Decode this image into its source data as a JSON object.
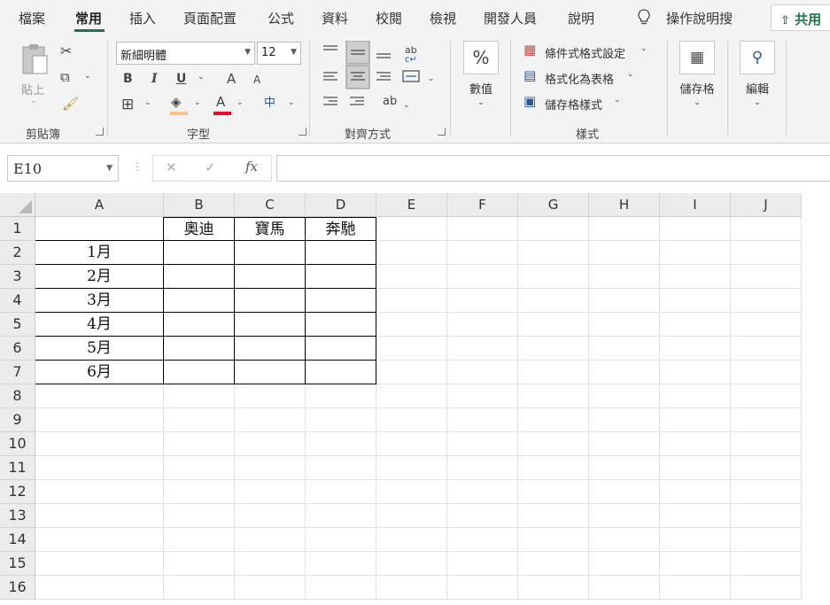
{
  "tabs": [
    "檔案",
    "常用",
    "插入",
    "頁面配置",
    "公式",
    "資料",
    "校閱",
    "檢視",
    "開發人員",
    "說明",
    "操作說明搜"
  ],
  "share_label": "共用",
  "ribbon": {
    "clipboard": {
      "paste_label": "貼上",
      "group_label": "剪貼簿"
    },
    "font": {
      "font_name": "新細明體",
      "font_size": "12",
      "bold": "B",
      "italic": "I",
      "underline": "U",
      "grow": "A",
      "shrink": "A",
      "font_color": "A",
      "phonetic": "中",
      "group_label": "字型"
    },
    "alignment": {
      "group_label": "對齊方式"
    },
    "number": {
      "symbol": "%",
      "label": "數值"
    },
    "styles": {
      "conditional": "條件式格式設定",
      "as_table": "格式化為表格",
      "cell_styles": "儲存格樣式",
      "group_label": "樣式"
    },
    "cells": {
      "label": "儲存格"
    },
    "editing": {
      "label": "編輯"
    }
  },
  "formula_bar": {
    "name_box": "E10",
    "cancel": "✕",
    "enter": "✓",
    "fx": "fx",
    "formula": ""
  },
  "sheet": {
    "columns": [
      "A",
      "B",
      "C",
      "D",
      "E",
      "F",
      "G",
      "H",
      "I",
      "J"
    ],
    "rows": [
      "1",
      "2",
      "3",
      "4",
      "5",
      "6",
      "7",
      "8",
      "9",
      "10",
      "11",
      "12",
      "13",
      "14",
      "15",
      "16"
    ],
    "cells": [
      [
        "",
        "奧迪",
        "寶馬",
        "奔馳"
      ],
      [
        "1月",
        "",
        "",
        ""
      ],
      [
        "2月",
        "",
        "",
        ""
      ],
      [
        "3月",
        "",
        "",
        ""
      ],
      [
        "4月",
        "",
        "",
        ""
      ],
      [
        "5月",
        "",
        "",
        ""
      ],
      [
        "6月",
        "",
        "",
        ""
      ]
    ]
  },
  "colors": {
    "accent": "#217346",
    "font_red": "#e81123",
    "fill_yellow": "#f6c38a"
  }
}
